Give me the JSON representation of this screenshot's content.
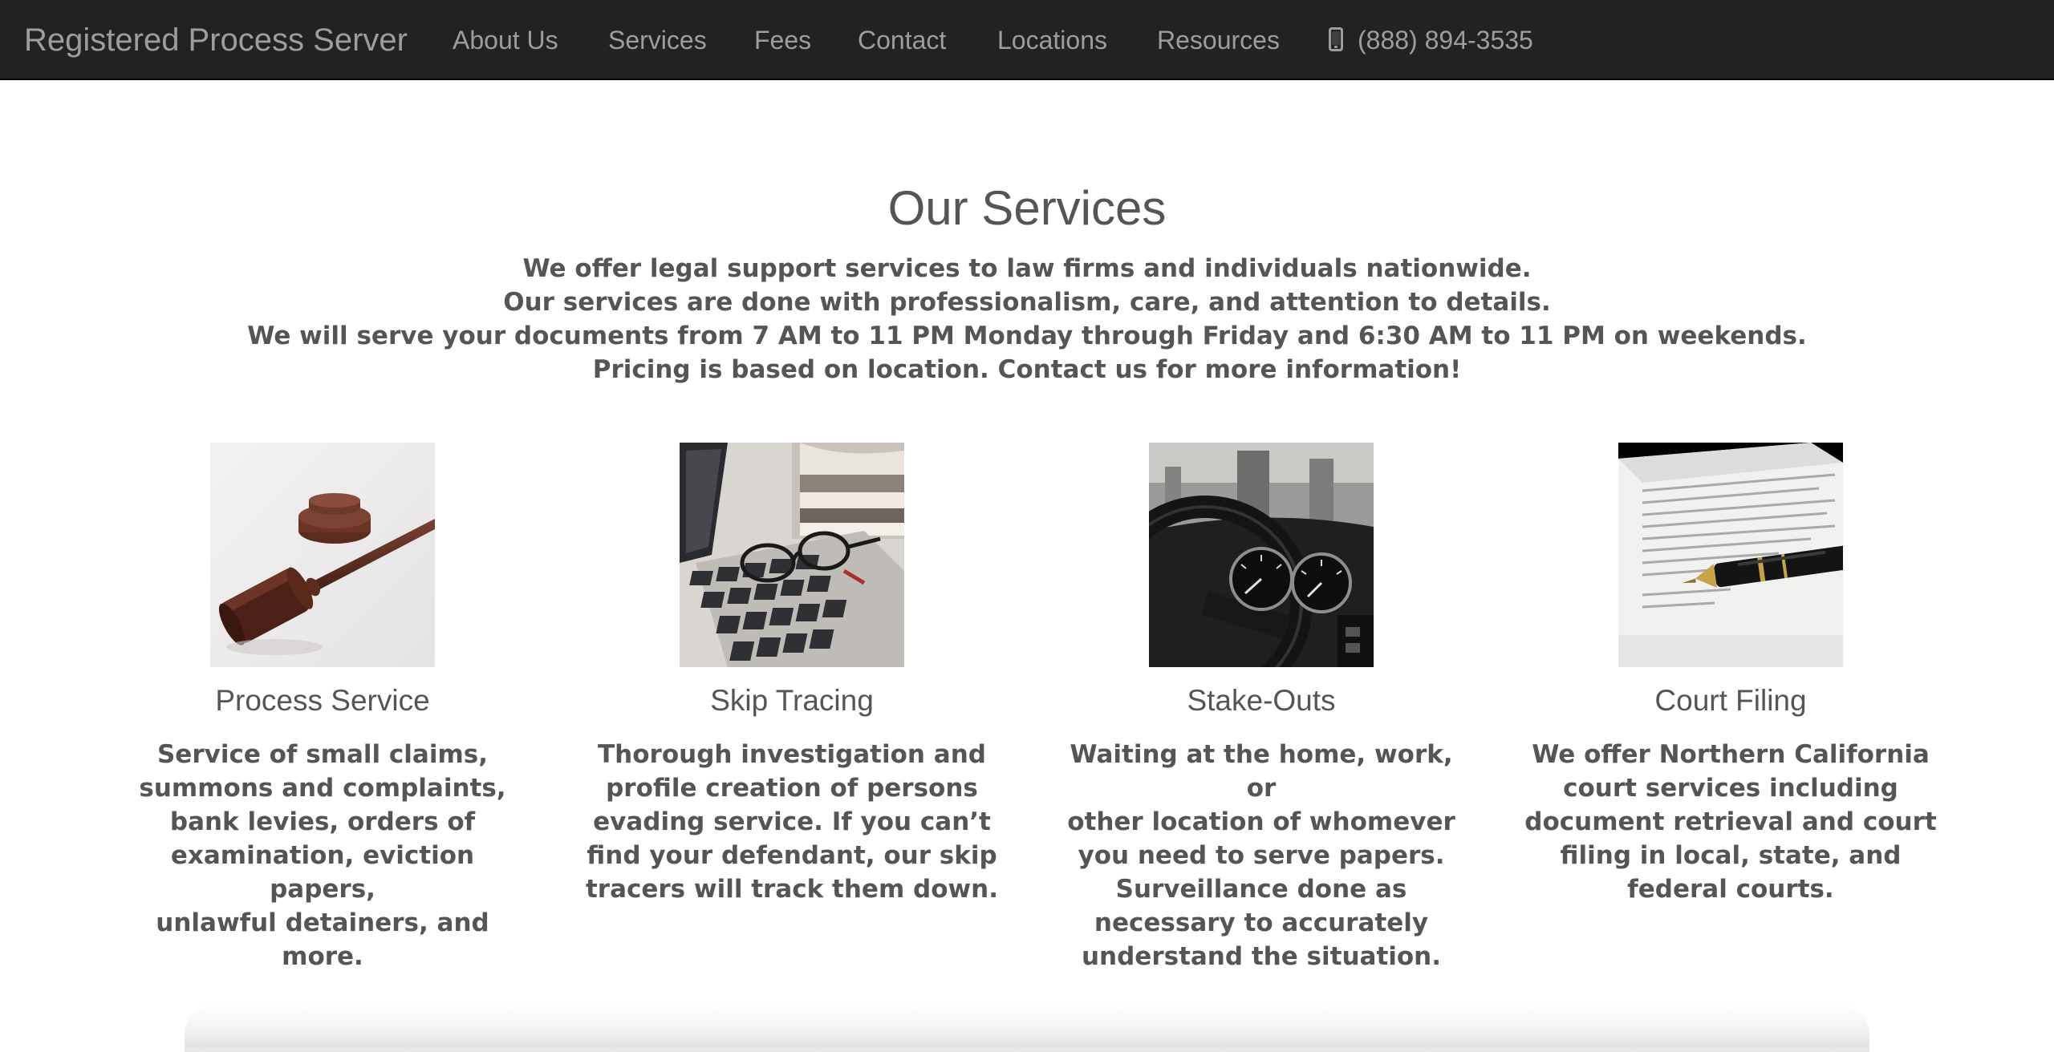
{
  "navbar": {
    "brand": "Registered Process Server",
    "links": [
      "About Us",
      "Services",
      "Fees",
      "Contact",
      "Locations",
      "Resources"
    ],
    "phone": "(888) 894-3535",
    "phone_icon": "mobile-phone-icon",
    "background_color": "#222222",
    "text_color": "#9d9d9d"
  },
  "main": {
    "title": "Our Services",
    "intro_lines": [
      "We offer legal support services to law firms and individuals nationwide.",
      "Our services are done with professionalism, care, and attention to details.",
      "We will serve your documents from 7 AM to 11 PM Monday through Friday and 6:30 AM to 11 PM on weekends.",
      "Pricing is based on location. Contact us for more information!"
    ],
    "services": [
      {
        "title": "Process Service",
        "image": "gavel-photo",
        "description_lines": [
          "Service of small claims,",
          "summons and complaints,",
          "bank levies, orders of",
          "examination, eviction papers,",
          "unlawful detainers, and more."
        ]
      },
      {
        "title": "Skip Tracing",
        "image": "laptop-and-glasses-photo",
        "description_lines": [
          "Thorough investigation and",
          "profile creation of persons",
          "evading service. If you can’t",
          "find your defendant, our skip",
          "tracers will track them down."
        ]
      },
      {
        "title": "Stake-Outs",
        "image": "car-dashboard-photo",
        "description_lines": [
          "Waiting at the home, work, or",
          "other location of whomever",
          "you need to serve papers.",
          "Surveillance done as",
          "necessary to accurately",
          "understand the situation."
        ]
      },
      {
        "title": "Court Filing",
        "image": "pen-on-document-photo",
        "description_lines": [
          "We offer Northern California",
          "court services including",
          "document retrieval and court",
          "filing in local, state, and",
          "federal courts."
        ]
      }
    ]
  }
}
